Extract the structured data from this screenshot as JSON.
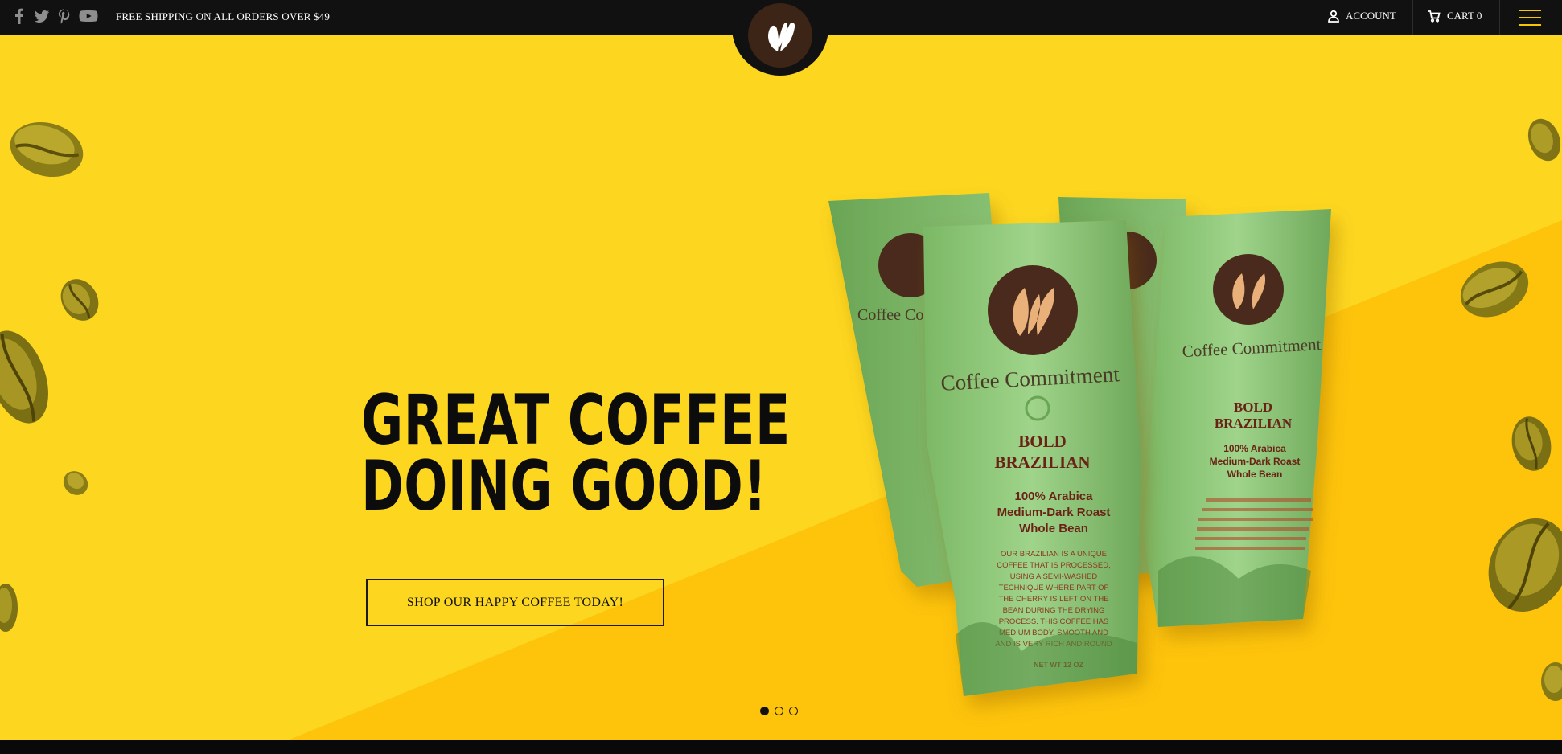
{
  "topbar": {
    "social_icons": [
      "facebook-icon",
      "twitter-icon",
      "pinterest-icon",
      "youtube-icon"
    ],
    "promo_text": "FREE SHIPPING ON ALL ORDERS OVER $49",
    "account_label": "ACCOUNT",
    "cart_label": "CART 0",
    "menu_icon": "hamburger-icon"
  },
  "brand": {
    "logo_icon": "coffee-bean-logo-icon"
  },
  "hero": {
    "headline_line1": "GREAT COFFEE",
    "headline_line2": "DOING GOOD!",
    "cta_label": "SHOP OUR HAPPY COFFEE TODAY!",
    "slide_count": 3,
    "active_slide": 1,
    "product": {
      "brand": "Coffee Commitment",
      "name_line1": "BOLD",
      "name_line2": "BRAZILIAN",
      "desc_line1": "100% Arabica",
      "desc_line2": "Medium-Dark Roast",
      "desc_line3": "Whole Bean",
      "body_lines": [
        "OUR BRAZILIAN IS A UNIQUE",
        "COFFEE THAT IS PROCESSED,",
        "USING A SEMI-WASHED",
        "TECHNIQUE WHERE PART OF",
        "THE CHERRY IS LEFT ON THE",
        "BEAN DURING THE DRYING",
        "PROCESS. THIS COFFEE HAS",
        "MEDIUM BODY, SMOOTH AND",
        "AND IS VERY RICH AND ROUND"
      ],
      "net_wt": "NET WT 12 OZ"
    }
  },
  "colors": {
    "topbar_bg": "#111111",
    "hero_yellow": "#fdd71f",
    "hero_yellow_dark": "#fec40b",
    "bag_green": "#8fc77a",
    "logo_brown": "#3c2416",
    "menu_accent": "#f7c600"
  }
}
